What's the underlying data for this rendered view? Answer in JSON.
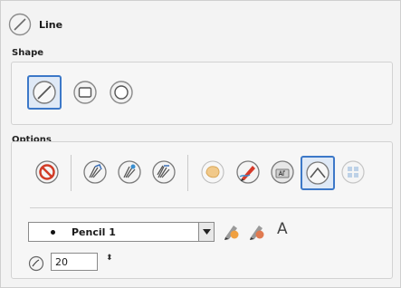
{
  "header": {
    "title": "Line",
    "icon": "line-tool-icon"
  },
  "shape": {
    "label": "Shape",
    "buttons": [
      {
        "name": "line-shape-button",
        "icon": "diagonal-line-icon",
        "active": true
      },
      {
        "name": "rectangle-shape-button",
        "icon": "rounded-rectangle-icon",
        "active": false
      },
      {
        "name": "ellipse-shape-button",
        "icon": "ellipse-icon",
        "active": false
      }
    ]
  },
  "options": {
    "label": "Options",
    "tools": [
      "no-entry-icon",
      "fan-brush-icon",
      "fan-brush-stroke-icon",
      "fan-brush-fill-icon",
      "paint-blob-icon",
      "red-pencil-icon",
      "text-sample-icon",
      "smooth-curve-icon",
      "grid-icon"
    ],
    "active_tool": "smooth-curve-icon",
    "pencil": {
      "value": "Pencil 1"
    },
    "font_glyph": "A",
    "size": {
      "value": "20",
      "stepper": "⬍"
    }
  },
  "colors": {
    "accent": "#3c78c8",
    "panel": "#f3f3f3",
    "border": "#cfcfcf"
  }
}
